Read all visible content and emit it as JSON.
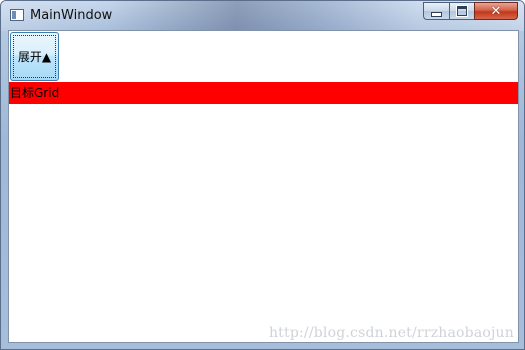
{
  "window": {
    "title": "MainWindow",
    "caption_buttons": {
      "minimize_icon": "minimize-icon",
      "maximize_icon": "maximize-icon",
      "close_icon": "close-icon",
      "close_glyph": "✕"
    }
  },
  "content": {
    "expand_button_label": "展开▲",
    "target_grid_label": "目标Grid",
    "target_grid_color": "#ff0000"
  },
  "watermark": "http://blog.csdn.net/rrzhaobaojun"
}
